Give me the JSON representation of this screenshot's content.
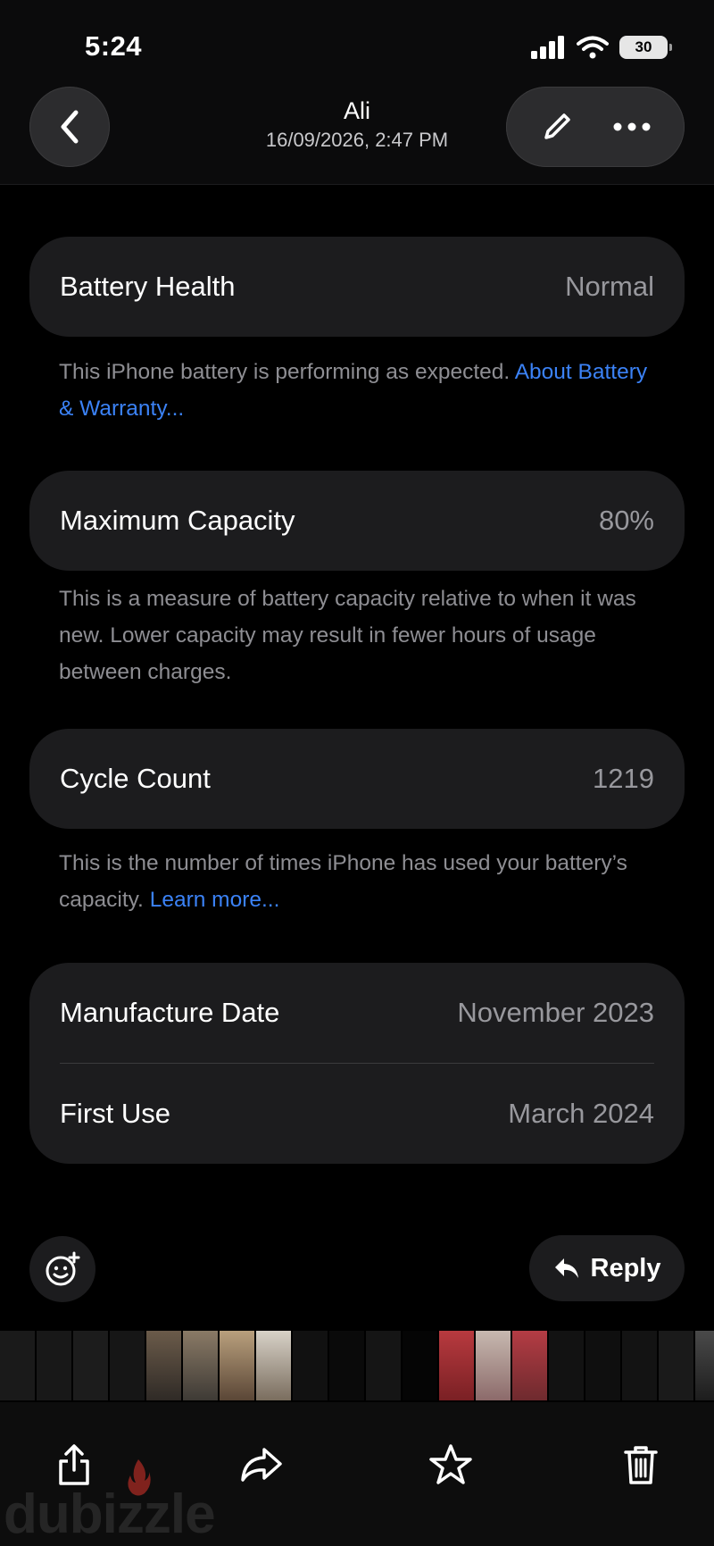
{
  "status_bar": {
    "time": "5:24",
    "battery_level": "30"
  },
  "header": {
    "sender": "Ali",
    "date": "16/09/2026, 2:47 PM"
  },
  "sections": {
    "battery_health": {
      "label": "Battery Health",
      "value": "Normal",
      "note": "This iPhone battery is performing as expected.",
      "link": "About Battery & Warranty..."
    },
    "max_capacity": {
      "label": "Maximum Capacity",
      "value": "80%",
      "note": "This is a measure of battery capacity relative to when it was new. Lower capacity may result in fewer hours of usage between charges."
    },
    "cycle_count": {
      "label": "Cycle Count",
      "value": "1219",
      "note": "This is the number of times iPhone has used your battery’s capacity.",
      "link": "Learn more..."
    },
    "dates": {
      "manufacture_label": "Manufacture Date",
      "manufacture_value": "November 2023",
      "first_use_label": "First Use",
      "first_use_value": "March 2024"
    }
  },
  "actions": {
    "reply_label": "Reply"
  },
  "watermark": "dubizzle",
  "colors": {
    "background": "#000000",
    "card": "#1c1c1e",
    "secondary_text": "#98989d",
    "link": "#3b82f6",
    "watermark_accent": "#e0352b"
  },
  "icons": [
    "back-chevron-icon",
    "pencil-icon",
    "more-icon",
    "add-emoji-icon",
    "reply-arrow-icon",
    "share-icon",
    "forward-icon",
    "star-icon",
    "trash-icon",
    "signal-icon",
    "wifi-icon",
    "battery-icon"
  ]
}
